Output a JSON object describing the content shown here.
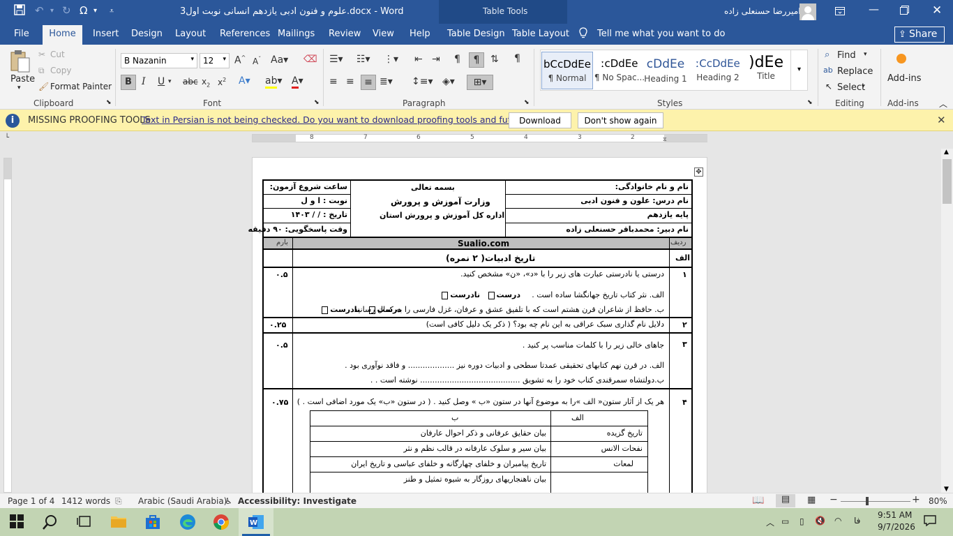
{
  "titlebar": {
    "doc_title": "علوم و فنون ادبی یازدهم انسانی نوبت اول3.docx  -  Word",
    "context_title": "Table Tools",
    "user_name": "امیررضا حسنعلی زاده"
  },
  "tabs": [
    "File",
    "Home",
    "Insert",
    "Design",
    "Layout",
    "References",
    "Mailings",
    "Review",
    "View",
    "Help",
    "Table Design",
    "Table Layout"
  ],
  "tell_me": "Tell me what you want to do",
  "share_label": "Share",
  "clipboard": {
    "paste": "Paste",
    "cut": "Cut",
    "copy": "Copy",
    "format_painter": "Format Painter",
    "group": "Clipboard"
  },
  "font": {
    "name": "B Nazanin",
    "size": "12",
    "group": "Font"
  },
  "paragraph": {
    "group": "Paragraph"
  },
  "styles": {
    "group": "Styles",
    "items": [
      {
        "preview": "bCcDdEe",
        "name": "¶ Normal"
      },
      {
        "preview": "ːcDdEe",
        "name": "¶ No Spac..."
      },
      {
        "preview": "cDdEe",
        "name": "Heading 1"
      },
      {
        "preview": "ːCcDdEe",
        "name": "Heading 2"
      },
      {
        "preview": ")dEe",
        "name": "Title"
      }
    ]
  },
  "editing": {
    "find": "Find",
    "replace": "Replace",
    "select": "Select",
    "group": "Editing"
  },
  "addins": {
    "label": "Add-ins",
    "group": "Add-ins"
  },
  "message_bar": {
    "title": "MISSING PROOFING TOOLS",
    "text": "Text in Persian is not being checked. Do you want to download proofing tools and future updates?",
    "download": "Download",
    "dont_show": "Don't show again"
  },
  "ruler_numbers": [
    "8",
    "7",
    "6",
    "5",
    "4",
    "3",
    "2",
    "1"
  ],
  "doc": {
    "header": {
      "student_name": "نام و نام خانوادگی:",
      "course": "نام درس: علون و فنون ادبی",
      "grade": "پایه یازدهم",
      "teacher": "نام دبیر: محمدباقر حسنعلی زاده",
      "bismillah": "بسمه تعالی",
      "ministry": "وزارت آموزش و پرورش",
      "office": "اداره کل آموزش و پرورش استان",
      "start_time": "ساعت شروع آزمون:",
      "session": "نوبت  :  ا و ل",
      "date": "تاریخ   :     /     /   ۱۴۰۳",
      "duration": "وقت پاسخگویی: ۹۰ دقیقه"
    },
    "col_row": "ردیف",
    "col_score": "بارم",
    "site": "Sualio.com",
    "section_letter": "الف",
    "section_title": "تاریخ ادبیات( ۲ نمره)",
    "q1": {
      "num": "۱",
      "text": "درستی یا نادرستی عبارت های زیر را با «د»، «ن» مشخص کنید.",
      "a": "الف. نثر کتاب تاریخ جهانگشا ساده است .",
      "b": "ب. حافظ از شاعران قرن هشتم است که با تلفیق عشق و عرفان، غزل فارسی را به کمال رسانید.",
      "true": "درست",
      "false": "نادرست",
      "score": "۰.۵"
    },
    "q2": {
      "num": "۲",
      "text": "دلایل نام گذاری سبک عراقی به این نام چه بود؟ ( ذکر یک دلیل کافی است)",
      "score": "۰.۲۵"
    },
    "q3": {
      "num": "۳",
      "text": "جاهای خالی زیر را با کلمات مناسب پر کنید .",
      "a": "الف. در قرن نهم کتابهای تحقیقی عمدتا سطحی و ادبیات دوره نیز ................... و فاقد نوآوری بود .",
      "b": "ب.دولتشاه سمرقندی کتاب خود را به تشویق ......................................... نوشته است .  .",
      "score": "۰.۵"
    },
    "q4": {
      "num": "۴",
      "text": "هر یک از آثار ستون« الف »را به موضوع آنها در ستون «ب » وصل کنید . ( در ستون «ب» یک مورد اضافی است . )",
      "score": "۰.۷۵",
      "col_a": "الف",
      "col_b": "ب",
      "rows": [
        {
          "a": "تاریخ گزیده",
          "b": "بیان حقایق عرفانی و ذکر احوال عارفان"
        },
        {
          "a": "نفحات الانس",
          "b": "بیان سیر و سلوک عارفانه در قالب نظم و نثر"
        },
        {
          "a": "لمعات",
          "b": "تاریخ پیامبران و خلفای چهارگانه و خلفای عباسی و تاریخ ایران"
        },
        {
          "a": "",
          "b": "بیان ناهنجاریهای روزگار به شیوه تمثیل و طنز"
        }
      ]
    }
  },
  "status": {
    "page": "Page 1 of 4",
    "words": "1412 words",
    "language": "Arabic (Saudi Arabia)",
    "accessibility": "Accessibility: Investigate",
    "zoom": "80%"
  },
  "taskbar": {
    "lang": "فا",
    "time": "9:51 AM",
    "date": "9/7/2026"
  }
}
